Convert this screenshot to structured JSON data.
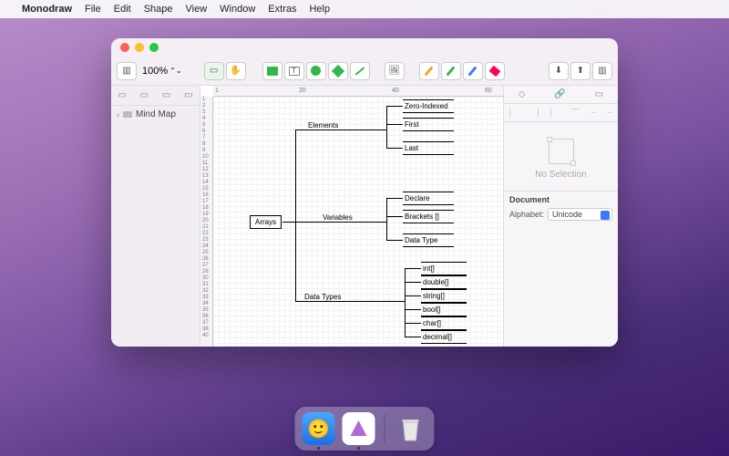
{
  "menubar": {
    "app": "Monodraw",
    "items": [
      "File",
      "Edit",
      "Shape",
      "View",
      "Window",
      "Extras",
      "Help"
    ]
  },
  "toolbar": {
    "zoom": "100%"
  },
  "sidebar": {
    "item": "Mind Map"
  },
  "ruler": {
    "h": [
      "1",
      "20",
      "40",
      "60"
    ],
    "v": [
      "1",
      "2",
      "3",
      "4",
      "5",
      "6",
      "7",
      "8",
      "9",
      "10",
      "11",
      "12",
      "13",
      "14",
      "15",
      "16",
      "17",
      "18",
      "19",
      "20",
      "21",
      "22",
      "23",
      "24",
      "25",
      "26",
      "27",
      "28",
      "30",
      "31",
      "32",
      "33",
      "34",
      "35",
      "36",
      "37",
      "38",
      "40"
    ]
  },
  "diagram": {
    "root": "Arrays",
    "branches": [
      {
        "label": "Elements",
        "leaves": [
          "Zero-Indexed",
          "First",
          "Last"
        ]
      },
      {
        "label": "Variables",
        "leaves": [
          "Declare",
          "Brackets []",
          "Data Type"
        ]
      },
      {
        "label": "Data Types",
        "leaves": [
          "int[]",
          "double[]",
          "string[]",
          "bool[]",
          "char[]",
          "decimal[]"
        ]
      }
    ]
  },
  "inspector": {
    "no_selection": "No Selection",
    "doc_header": "Document",
    "alphabet_label": "Alphabet:",
    "alphabet_value": "Unicode"
  },
  "dock": {
    "items": [
      "Finder",
      "Monodraw",
      "Trash"
    ]
  }
}
